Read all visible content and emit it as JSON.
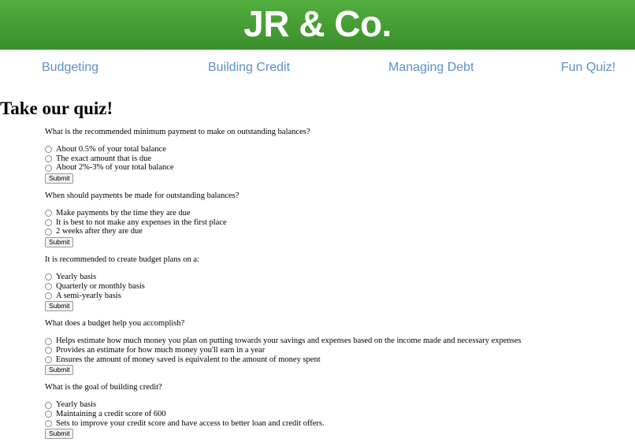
{
  "header": {
    "brand": "JR & Co."
  },
  "nav": [
    {
      "label": "Budgeting"
    },
    {
      "label": "Building Credit"
    },
    {
      "label": "Managing Debt"
    },
    {
      "label": "Fun Quiz!"
    }
  ],
  "page": {
    "heading": "Take our quiz!"
  },
  "quiz": [
    {
      "question": "What is the recommended minimum payment to make on outstanding balances?",
      "options": [
        "About 0.5% of your total balance",
        "The exact amount that is due",
        "About 2%-3% of your total balance"
      ],
      "submit": "Submit"
    },
    {
      "question": "When should payments be made for outstanding balances?",
      "options": [
        "Make payments by the time they are due",
        "It is best to not make any expenses in the first place",
        "2 weeks after they are due"
      ],
      "submit": "Submit"
    },
    {
      "question": "It is recommended to create budget plans on a:",
      "options": [
        "Yearly basis",
        "Quarterly or monthly basis",
        "A semi-yearly basis"
      ],
      "submit": "Submit"
    },
    {
      "question": "What does a budget help you accomplish?",
      "options": [
        "Helps estimate how much money you plan on putting towards your savings and expenses based on the income made and necessary expenses",
        "Provides an estimate for how much money you'll earn in a year",
        "Ensures the amount of money saved is equivalent to the amount of money spent"
      ],
      "submit": "Submit"
    },
    {
      "question": "What is the goal of building credit?",
      "options": [
        "Yearly basis",
        "Maintaining a credit score of 600",
        "Sets to improve your credit score and have access to better loan and credit offers."
      ],
      "submit": "Submit"
    }
  ]
}
